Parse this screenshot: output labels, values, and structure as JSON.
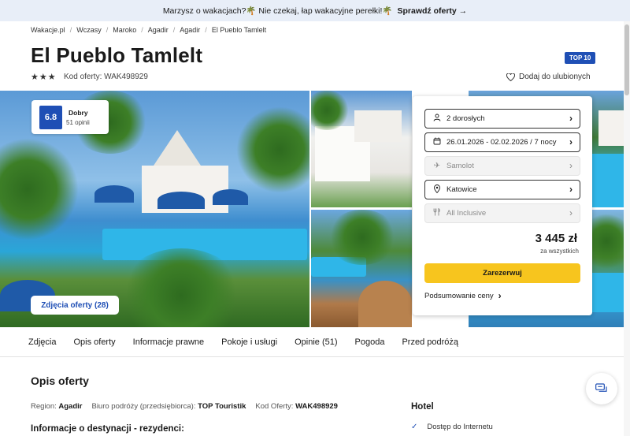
{
  "topbar": {
    "message": "Marzysz o wakacjach?🌴 Nie czekaj, łap wakacyjne perełki!🌴",
    "cta": "Sprawdź oferty →"
  },
  "breadcrumbs": [
    "Wakacje.pl",
    "Wczasy",
    "Maroko",
    "Agadir",
    "Agadir",
    "El Pueblo Tamlelt"
  ],
  "hotel": {
    "name": "El Pueblo Tamlelt",
    "badge": "TOP 10",
    "stars": "★★★",
    "offer_code_label": "Kod oferty: WAK498929",
    "favorite_label": "Dodaj do ulubionych",
    "rating": {
      "score": "6.8",
      "label": "Dobry",
      "count": "51 opinii"
    },
    "photos_button": "Zdjęcia oferty (28)"
  },
  "booking": {
    "travelers": "2 dorosłych",
    "dates": "26.01.2026 - 02.02.2026 / 7 nocy",
    "transport": "Samolot",
    "departure": "Katowice",
    "board": "All Inclusive",
    "price": "3 445 zł",
    "price_note": "za wszystkich",
    "book_button": "Zarezerwuj",
    "summary_link": "Podsumowanie ceny"
  },
  "tabs": [
    "Zdjęcia",
    "Opis oferty",
    "Informacje prawne",
    "Pokoje i usługi",
    "Opinie (51)",
    "Pogoda",
    "Przed podróżą"
  ],
  "content": {
    "heading": "Opis oferty",
    "region_label": "Region:",
    "region_value": "Agadir",
    "operator_label": "Biuro podróży (przedsiębiorca):",
    "operator_value": "TOP Touristik",
    "code_label": "Kod Oferty:",
    "code_value": "WAK498929",
    "subheading": "Informacje o destynacji - rezydenci:",
    "hotel_heading": "Hotel",
    "amenity": "Dostęp do Internetu"
  },
  "colors": {
    "brand_blue": "#1f4fb5",
    "book_yellow": "#f7c51e",
    "topbar_bg": "#e8eef8"
  }
}
